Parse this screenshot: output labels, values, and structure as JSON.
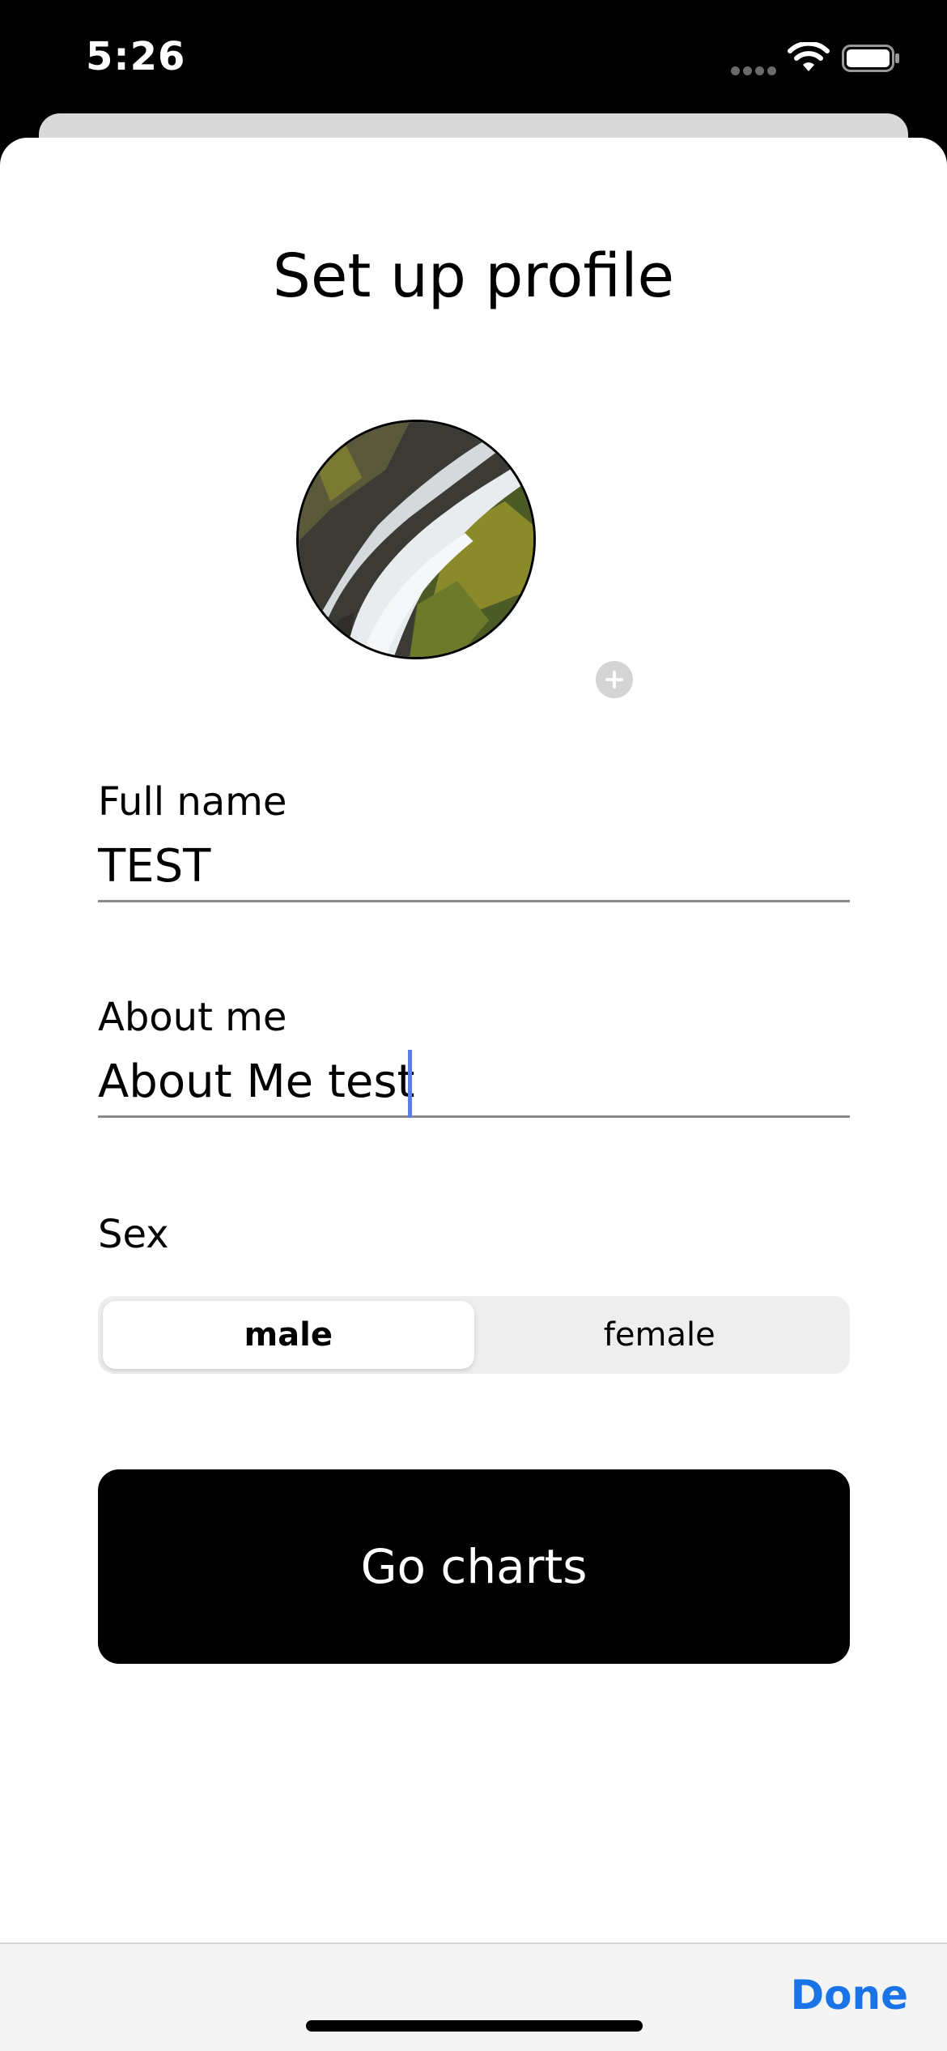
{
  "status_bar": {
    "time": "5:26"
  },
  "sheet": {
    "title": "Set up profile"
  },
  "profile_photo": {
    "add_icon": "plus-circle-icon"
  },
  "full_name": {
    "label": "Full name",
    "value": "TEST"
  },
  "about_me": {
    "label": "About me",
    "value": "About Me test"
  },
  "sex": {
    "label": "Sex",
    "options": [
      "male",
      "female"
    ],
    "selected": "male"
  },
  "primary_action": {
    "label": "Go charts"
  },
  "keyboard_accessory": {
    "done_label": "Done"
  },
  "colors": {
    "accent": "#1a74e8",
    "cursor": "#5e7ce8",
    "button_bg": "#000000"
  }
}
